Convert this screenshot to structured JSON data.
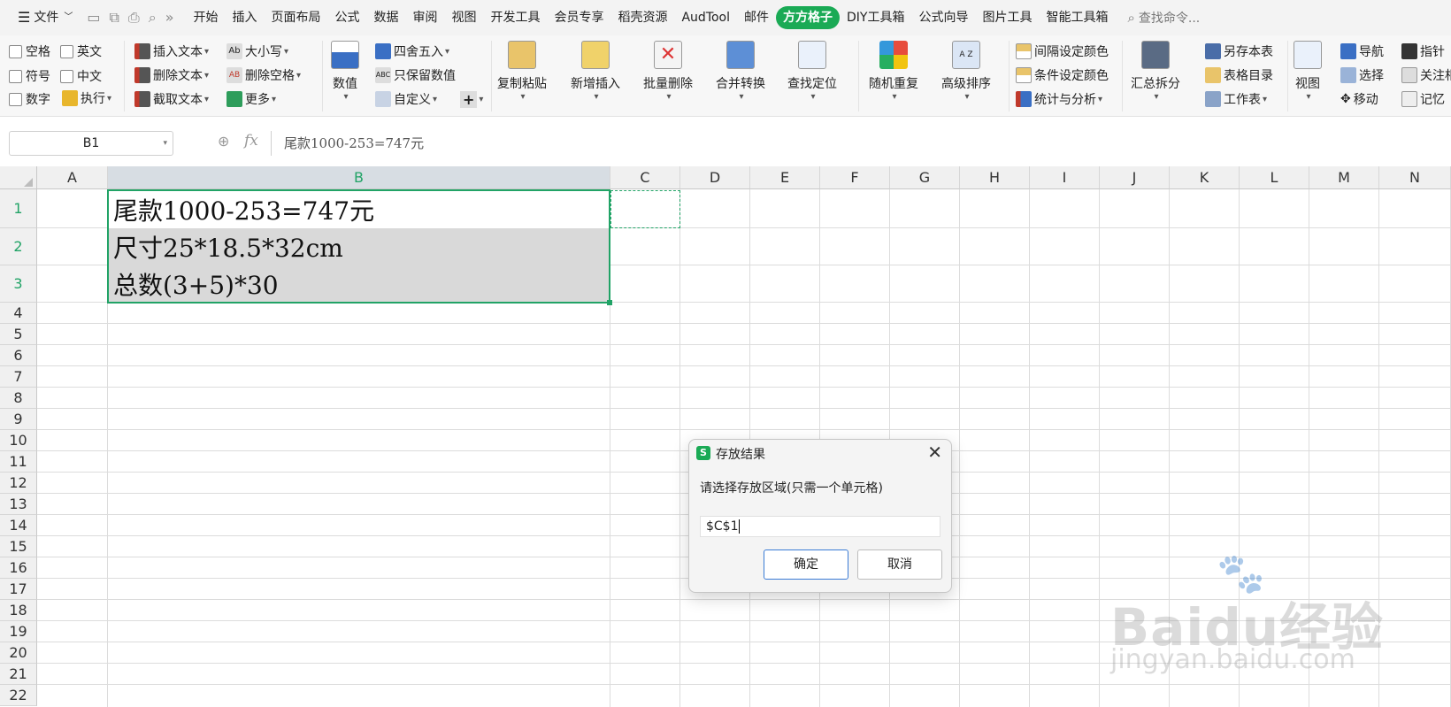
{
  "menubar": {
    "file": "文件",
    "tabs": [
      "开始",
      "插入",
      "页面布局",
      "公式",
      "数据",
      "审阅",
      "视图",
      "开发工具",
      "会员专享",
      "稻壳资源",
      "AudTool",
      "邮件",
      "方方格子",
      "DIY工具箱",
      "公式向导",
      "图片工具",
      "智能工具箱"
    ],
    "active_tab": "方方格子",
    "search_placeholder": "查找命令..."
  },
  "ribbon": {
    "checks": [
      "空格",
      "英文",
      "符号",
      "中文",
      "数字"
    ],
    "execute": "执行",
    "text_ops": [
      "插入文本",
      "删除文本",
      "截取文本"
    ],
    "case_ops": [
      "大小写",
      "删除空格",
      "更多"
    ],
    "numeric": "数值",
    "round": "四舍五入",
    "keep_values": "只保留数值",
    "custom": "自定义",
    "big_buttons": [
      "复制粘贴",
      "新增插入",
      "批量删除",
      "合并转换",
      "查找定位",
      "随机重复",
      "高级排序"
    ],
    "color_ops": [
      "间隔设定颜色",
      "条件设定颜色",
      "统计与分析"
    ],
    "summary_split": "汇总拆分",
    "save_ops": [
      "另存本表",
      "表格目录",
      "工作表"
    ],
    "view": "视图",
    "nav_ops": [
      "导航",
      "选择",
      "移动"
    ],
    "right_ops": [
      "指针",
      "关注相",
      "记忆"
    ]
  },
  "formula_bar": {
    "name_box": "B1",
    "fx": "fx",
    "content": "尾款1000-253=747元"
  },
  "grid": {
    "columns": [
      "A",
      "B",
      "C",
      "D",
      "E",
      "F",
      "G",
      "H",
      "I",
      "J",
      "K",
      "L",
      "M",
      "N"
    ],
    "rows": [
      "1",
      "2",
      "3",
      "4",
      "5",
      "6",
      "7",
      "8",
      "9",
      "10",
      "11",
      "12",
      "13",
      "14",
      "15",
      "16",
      "17",
      "18",
      "19",
      "20",
      "21",
      "22"
    ],
    "cells": {
      "B1": "尾款1000-253=747元",
      "B2": "尺寸25*18.5*32cm",
      "B3": "总数(3+5)*30"
    }
  },
  "dialog": {
    "app_icon": "S",
    "title": "存放结果",
    "prompt": "请选择存放区域(只需一个单元格)",
    "input_value": "$C$1",
    "ok": "确定",
    "cancel": "取消"
  },
  "watermark": {
    "brand": "Baidu经验",
    "url": "jingyan.baidu.com"
  },
  "colors": {
    "accent": "#1aaa55",
    "selection_border": "#21a366",
    "selected_fill": "#d9d9d9"
  }
}
